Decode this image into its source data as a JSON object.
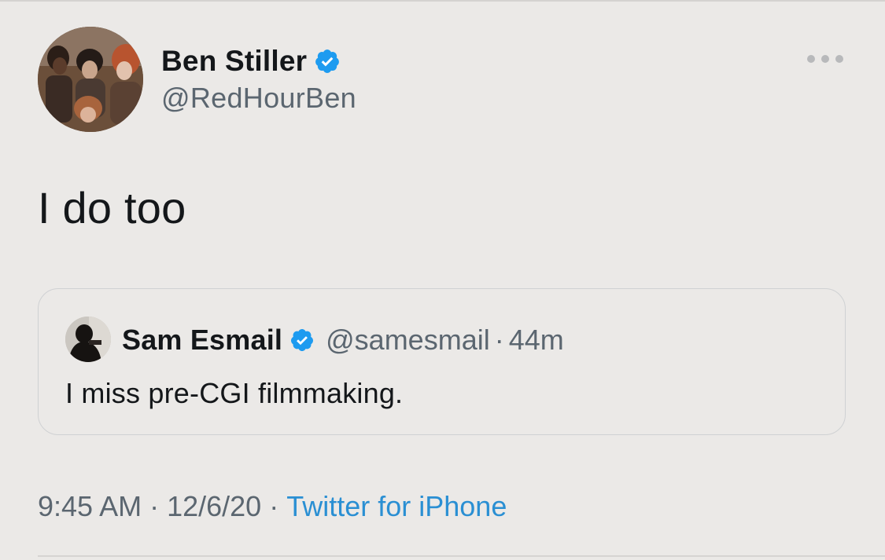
{
  "tweet": {
    "author": {
      "name": "Ben Stiller",
      "handle": "@RedHourBen",
      "verified": true
    },
    "text": "I do too",
    "more_icon": "ellipsis-icon",
    "quoted": {
      "name": "Sam Esmail",
      "handle": "@samesmail",
      "separator": "·",
      "time": "44m",
      "verified": true,
      "text": "I miss pre-CGI filmmaking."
    },
    "meta": {
      "time": "9:45 AM",
      "separator": "·",
      "date": "12/6/20",
      "source": "Twitter for iPhone"
    }
  },
  "colors": {
    "background": "#ebe9e7",
    "verified_blue": "#1d9bf0",
    "link_blue": "#2a8fd3",
    "secondary_text": "#5b6670",
    "card_border": "#cfd1d3"
  }
}
